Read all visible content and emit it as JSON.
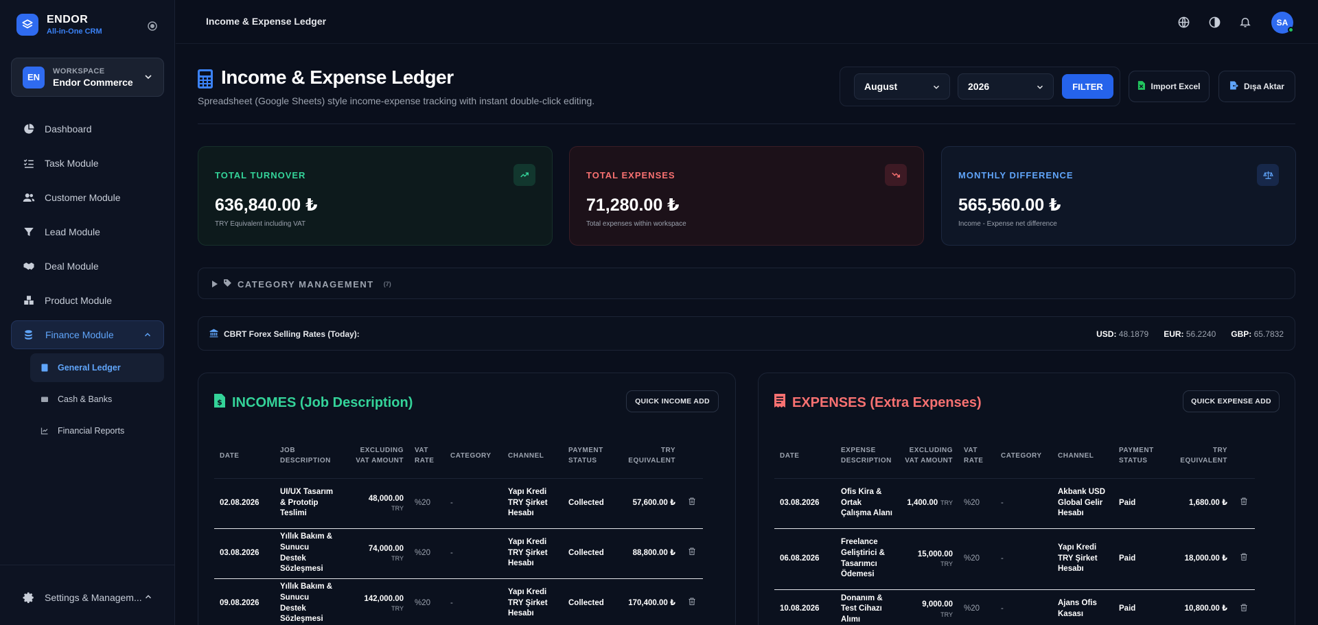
{
  "brand": {
    "name": "ENDOR",
    "subtitle": "All-in-One CRM"
  },
  "workspace": {
    "avatar": "EN",
    "label": "WORKSPACE",
    "name": "Endor Commerce"
  },
  "nav": {
    "items": [
      {
        "label": "Dashboard",
        "icon": "pie-chart-icon"
      },
      {
        "label": "Task Module",
        "icon": "checklist-icon"
      },
      {
        "label": "Customer Module",
        "icon": "users-icon"
      },
      {
        "label": "Lead Module",
        "icon": "filter-icon"
      },
      {
        "label": "Deal Module",
        "icon": "handshake-icon"
      },
      {
        "label": "Product Module",
        "icon": "boxes-icon"
      },
      {
        "label": "Finance Module",
        "icon": "coins-icon"
      }
    ],
    "sub_items": [
      {
        "label": "General Ledger",
        "icon": "calculator-icon"
      },
      {
        "label": "Cash & Banks",
        "icon": "wallet-icon"
      },
      {
        "label": "Financial Reports",
        "icon": "line-chart-icon"
      }
    ],
    "footer_label": "Settings & Managem..."
  },
  "topbar": {
    "title": "Income & Expense Ledger",
    "avatar": "SA"
  },
  "header": {
    "title": "Income & Expense Ledger",
    "subtitle": "Spreadsheet (Google Sheets) style income-expense tracking with instant double-click editing.",
    "month": "August",
    "year": "2026",
    "filter_label": "FILTER",
    "import_label": "Import Excel",
    "export_label": "Dışa Aktar"
  },
  "stats": {
    "turnover": {
      "label": "TOTAL TURNOVER",
      "value": "636,840.00 ₺",
      "note": "TRY Equivalent including VAT"
    },
    "expenses": {
      "label": "TOTAL EXPENSES",
      "value": "71,280.00 ₺",
      "note": "Total expenses within workspace"
    },
    "difference": {
      "label": "MONTHLY DIFFERENCE",
      "value": "565,560.00 ₺",
      "note": "Income - Expense net difference"
    }
  },
  "category": {
    "label": "CATEGORY MANAGEMENT",
    "count": "(7)"
  },
  "forex": {
    "title": "CBRT Forex Selling Rates (Today):",
    "usd_label": "USD:",
    "usd": "48.1879",
    "eur_label": "EUR:",
    "eur": "56.2240",
    "gbp_label": "GBP:",
    "gbp": "65.7832"
  },
  "incomes": {
    "title": "INCOMES (Job Description)",
    "button": "QUICK INCOME ADD",
    "headers": {
      "date": "DATE",
      "desc1": "JOB",
      "desc2": "DESCRIPTION",
      "amt1": "EXCLUDING",
      "amt2": "VAT AMOUNT",
      "vat1": "VAT",
      "vat2": "RATE",
      "category": "CATEGORY",
      "channel": "CHANNEL",
      "status1": "PAYMENT",
      "status2": "STATUS",
      "try1": "TRY",
      "try2": "EQUIVALENT"
    },
    "rows": [
      {
        "date": "02.08.2026",
        "desc": "UI/UX Tasarım & Prototip Teslimi",
        "amount": "48,000.00",
        "cur": "TRY",
        "vat": "%20",
        "category": "-",
        "channel": "Yapı Kredi TRY Şirket Hesabı",
        "status": "Collected",
        "try": "57,600.00 ₺"
      },
      {
        "date": "03.08.2026",
        "desc": "Yıllık Bakım & Sunucu Destek Sözleşmesi",
        "amount": "74,000.00",
        "cur": "TRY",
        "vat": "%20",
        "category": "-",
        "channel": "Yapı Kredi TRY Şirket Hesabı",
        "status": "Collected",
        "try": "88,800.00 ₺"
      },
      {
        "date": "09.08.2026",
        "desc": "Yıllık Bakım & Sunucu Destek Sözleşmesi",
        "amount": "142,000.00",
        "cur": "TRY",
        "vat": "%20",
        "category": "-",
        "channel": "Yapı Kredi TRY Şirket Hesabı",
        "status": "Collected",
        "try": "170,400.00 ₺"
      }
    ]
  },
  "expenses": {
    "title": "EXPENSES (Extra Expenses)",
    "button": "QUICK EXPENSE ADD",
    "headers": {
      "date": "DATE",
      "desc1": "EXPENSE",
      "desc2": "DESCRIPTION",
      "amt1": "EXCLUDING",
      "amt2": "VAT AMOUNT",
      "vat1": "VAT",
      "vat2": "RATE",
      "category": "CATEGORY",
      "channel": "CHANNEL",
      "status1": "PAYMENT",
      "status2": "STATUS",
      "try1": "TRY",
      "try2": "EQUIVALENT"
    },
    "rows": [
      {
        "date": "03.08.2026",
        "desc": "Ofis Kira & Ortak Çalışma Alanı",
        "amount": "1,400.00",
        "cur": "TRY",
        "vat": "%20",
        "category": "-",
        "channel": "Akbank USD Global Gelir Hesabı",
        "status": "Paid",
        "try": "1,680.00 ₺"
      },
      {
        "date": "06.08.2026",
        "desc": "Freelance Geliştirici & Tasarımcı Ödemesi",
        "amount": "15,000.00",
        "cur": "TRY",
        "vat": "%20",
        "category": "-",
        "channel": "Yapı Kredi TRY Şirket Hesabı",
        "status": "Paid",
        "try": "18,000.00 ₺"
      },
      {
        "date": "10.08.2026",
        "desc": "Donanım & Test Cihazı Alımı",
        "amount": "9,000.00",
        "cur": "TRY",
        "vat": "%20",
        "category": "-",
        "channel": "Ajans Ofis Kasası",
        "status": "Paid",
        "try": "10,800.00 ₺"
      }
    ]
  },
  "colors": {
    "accent": "#2563eb",
    "income": "#34d399",
    "expense": "#f87171",
    "difference": "#60a5fa"
  }
}
